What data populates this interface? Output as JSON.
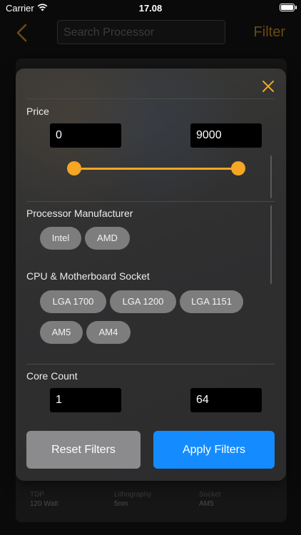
{
  "status_bar": {
    "carrier": "Carrier",
    "time": "17.08"
  },
  "nav": {
    "search_placeholder": "Search Processor",
    "filter_label": "Filter"
  },
  "background_specs": [
    {
      "label": "TDP",
      "value": "120 Watt"
    },
    {
      "label": "Lithography",
      "value": "5nm"
    },
    {
      "label": "Socket",
      "value": "AM5"
    }
  ],
  "filter_modal": {
    "price": {
      "title": "Price",
      "min": "0",
      "max": "9000",
      "range_fraction": [
        0.0,
        1.0
      ]
    },
    "manufacturer": {
      "title": "Processor Manufacturer",
      "options": [
        "Intel",
        "AMD"
      ]
    },
    "socket": {
      "title": "CPU & Motherboard Socket",
      "options": [
        "LGA 1700",
        "LGA 1200",
        "LGA 1151",
        "AM5",
        "AM4"
      ]
    },
    "core_count": {
      "title": "Core Count",
      "min": "1",
      "max": "64"
    },
    "reset_label": "Reset Filters",
    "apply_label": "Apply Filters"
  },
  "colors": {
    "accent": "#f5a623",
    "primary_button": "#148cff",
    "chip": "#7d7d7d"
  },
  "icons": {
    "back": "chevron-left-icon",
    "close": "close-icon",
    "wifi": "wifi-icon",
    "battery": "battery-icon"
  }
}
